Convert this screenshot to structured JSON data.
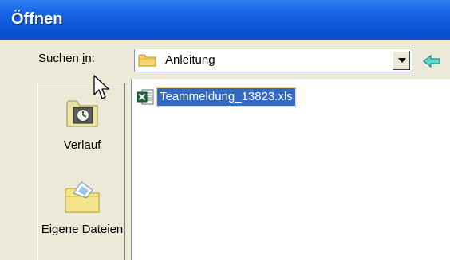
{
  "dialog": {
    "title": "Öffnen"
  },
  "lookin": {
    "label_before": "Suchen ",
    "label_access_key": "i",
    "label_after": "n:",
    "value": "Anleitung",
    "folder_icon": "folder-icon",
    "dropdown_icon": "chevron-down-icon",
    "back_icon": "back-arrow-icon"
  },
  "places_bar": {
    "items": [
      {
        "label": "Verlauf",
        "icon": "history-clock-icon"
      },
      {
        "label": "Eigene Dateien",
        "icon": "my-documents-folder-icon"
      }
    ]
  },
  "file_list": {
    "items": [
      {
        "name": "Teammeldung_13823.xls",
        "icon": "excel-file-icon",
        "selected": true
      }
    ]
  },
  "colors": {
    "titlebar": "#0a54d6",
    "window_bg": "#ece9d8",
    "selection": "#316ac5",
    "back_arrow": "#2fb3a8"
  }
}
